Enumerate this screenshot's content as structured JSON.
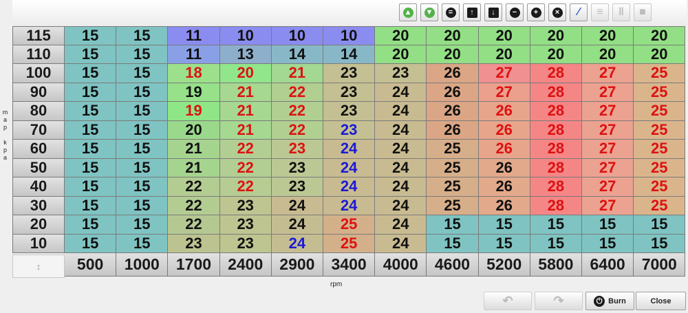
{
  "toolbar": {
    "buttons": [
      {
        "name": "increase-fine-button",
        "icon": "arrow-up-circle-icon",
        "glyph": "▲",
        "fg": "#ffffff",
        "bg": "#55b24a",
        "disabled": false
      },
      {
        "name": "decrease-fine-button",
        "icon": "arrow-down-circle-icon",
        "glyph": "▼",
        "fg": "#ffffff",
        "bg": "#55b24a",
        "disabled": false
      },
      {
        "name": "set-equal-button",
        "icon": "equals-circle-icon",
        "glyph": "=",
        "fg": "#ffffff",
        "bg": "#1a1a1a",
        "disabled": false
      },
      {
        "name": "increase-button",
        "icon": "arrow-up-square-icon",
        "glyph": "↑",
        "fg": "#ffffff",
        "bg": "#1a1a1a",
        "disabled": false
      },
      {
        "name": "decrease-button",
        "icon": "arrow-down-square-icon",
        "glyph": "↓",
        "fg": "#ffffff",
        "bg": "#1a1a1a",
        "disabled": false
      },
      {
        "name": "subtract-button",
        "icon": "minus-circle-icon",
        "glyph": "−",
        "fg": "#ffffff",
        "bg": "#1a1a1a",
        "disabled": false
      },
      {
        "name": "add-button",
        "icon": "plus-circle-icon",
        "glyph": "+",
        "fg": "#ffffff",
        "bg": "#1a1a1a",
        "disabled": false
      },
      {
        "name": "multiply-button",
        "icon": "times-circle-icon",
        "glyph": "×",
        "fg": "#ffffff",
        "bg": "#1a1a1a",
        "disabled": false
      },
      {
        "name": "interpolate-button",
        "icon": "pencil-icon",
        "glyph": "∕",
        "fg": "#2a54c8",
        "bg": "transparent",
        "disabled": false
      },
      {
        "name": "smooth-rows-button",
        "icon": "horizontal-lines-icon",
        "glyph": "≡",
        "fg": "#bdbdbd",
        "bg": "transparent",
        "disabled": true
      },
      {
        "name": "smooth-columns-button",
        "icon": "vertical-lines-icon",
        "glyph": "‖",
        "fg": "#bdbdbd",
        "bg": "transparent",
        "disabled": true
      },
      {
        "name": "smooth-all-button",
        "icon": "square-fill-icon",
        "glyph": "■",
        "fg": "#bdbdbd",
        "bg": "transparent",
        "disabled": true
      }
    ]
  },
  "table": {
    "y_axis_label": "MAP kPa",
    "x_axis_label": "rpm",
    "corner_icon": "axis-corner-icon",
    "corner_glyph": "↕",
    "row_headers": [
      "115",
      "110",
      "100",
      "90",
      "80",
      "70",
      "60",
      "50",
      "40",
      "30",
      "20",
      "10"
    ],
    "col_headers": [
      "500",
      "1000",
      "1700",
      "2400",
      "2900",
      "3400",
      "4000",
      "4600",
      "5200",
      "5800",
      "6400",
      "7000"
    ],
    "values": [
      [
        "15",
        "15",
        "11",
        "10",
        "10",
        "10",
        "20",
        "20",
        "20",
        "20",
        "20",
        "20"
      ],
      [
        "15",
        "15",
        "11",
        "13",
        "14",
        "14",
        "20",
        "20",
        "20",
        "20",
        "20",
        "20"
      ],
      [
        "15",
        "15",
        "18",
        "20",
        "21",
        "23",
        "23",
        "26",
        "27",
        "28",
        "27",
        "25"
      ],
      [
        "15",
        "15",
        "19",
        "21",
        "22",
        "23",
        "24",
        "26",
        "27",
        "28",
        "27",
        "25"
      ],
      [
        "15",
        "15",
        "19",
        "21",
        "22",
        "23",
        "24",
        "26",
        "26",
        "28",
        "27",
        "25"
      ],
      [
        "15",
        "15",
        "20",
        "21",
        "22",
        "23",
        "24",
        "26",
        "26",
        "28",
        "27",
        "25"
      ],
      [
        "15",
        "15",
        "21",
        "22",
        "23",
        "24",
        "24",
        "25",
        "26",
        "28",
        "27",
        "25"
      ],
      [
        "15",
        "15",
        "21",
        "22",
        "23",
        "24",
        "24",
        "25",
        "26",
        "28",
        "27",
        "25"
      ],
      [
        "15",
        "15",
        "22",
        "22",
        "23",
        "24",
        "24",
        "25",
        "26",
        "28",
        "27",
        "25"
      ],
      [
        "15",
        "15",
        "22",
        "23",
        "24",
        "24",
        "24",
        "25",
        "26",
        "28",
        "27",
        "25"
      ],
      [
        "15",
        "15",
        "22",
        "23",
        "24",
        "25",
        "24",
        "15",
        "15",
        "15",
        "15",
        "15"
      ],
      [
        "15",
        "15",
        "23",
        "23",
        "24",
        "25",
        "24",
        "15",
        "15",
        "15",
        "15",
        "15"
      ]
    ],
    "cell_colors": [
      [
        "#7fc4c2",
        "#7fc4c2",
        "#8b8cf0",
        "#8b8cf0",
        "#8b8cf0",
        "#8b8cf0",
        "#93df85",
        "#93df85",
        "#93df85",
        "#93df85",
        "#93df85",
        "#93df85"
      ],
      [
        "#7fc4c2",
        "#7fc4c2",
        "#8aa0e6",
        "#8eafcc",
        "#88b8c8",
        "#88b8c8",
        "#93df85",
        "#93df85",
        "#93df85",
        "#93df85",
        "#93df85",
        "#93df85"
      ],
      [
        "#7fc4c2",
        "#7fc4c2",
        "#9ce08c",
        "#91e58a",
        "#a2d892",
        "#c5c093",
        "#c5c093",
        "#dba686",
        "#f09090",
        "#f58686",
        "#eca290",
        "#dab58c"
      ],
      [
        "#7fc4c2",
        "#7fc4c2",
        "#96e189",
        "#a6d891",
        "#b0cf91",
        "#c5c093",
        "#c9bb91",
        "#dba686",
        "#eba08d",
        "#f58686",
        "#eca290",
        "#dab58c"
      ],
      [
        "#7fc4c2",
        "#7fc4c2",
        "#8fe686",
        "#a6d891",
        "#b0cf91",
        "#c5c093",
        "#c9bb91",
        "#dba686",
        "#e7a58c",
        "#f58686",
        "#eca290",
        "#dab58c"
      ],
      [
        "#7fc4c2",
        "#7fc4c2",
        "#9ad98b",
        "#a6d891",
        "#b0cf91",
        "#c5c093",
        "#c9bb91",
        "#dba686",
        "#e7a58c",
        "#f58686",
        "#eca290",
        "#dab58c"
      ],
      [
        "#7fc4c2",
        "#7fc4c2",
        "#a5d48f",
        "#b3ce93",
        "#bcc894",
        "#c9bb91",
        "#c9bb91",
        "#d7ae8a",
        "#e7a58c",
        "#f58686",
        "#eca290",
        "#dab58c"
      ],
      [
        "#7fc4c2",
        "#7fc4c2",
        "#a5d48f",
        "#b3ce93",
        "#bcc894",
        "#c9bb91",
        "#c9bb91",
        "#d7ae8a",
        "#e3a98b",
        "#f58686",
        "#eca290",
        "#dab58c"
      ],
      [
        "#7fc4c2",
        "#7fc4c2",
        "#b3cc92",
        "#b6cc92",
        "#bcc894",
        "#c9bb91",
        "#c9bb91",
        "#d7ae8a",
        "#e3a98b",
        "#f58686",
        "#eca290",
        "#dab58c"
      ],
      [
        "#7fc4c2",
        "#7fc4c2",
        "#b3cc92",
        "#bec591",
        "#c9bb91",
        "#c9bb91",
        "#c9bb91",
        "#d7ae8a",
        "#e3a98b",
        "#f58686",
        "#eca290",
        "#dab58c"
      ],
      [
        "#7fc4c2",
        "#7fc4c2",
        "#b6c892",
        "#bec591",
        "#c5bd92",
        "#d3b08a",
        "#c9bb91",
        "#7fc4c2",
        "#7fc4c2",
        "#7fc4c2",
        "#7fc4c2",
        "#7fc4c2"
      ],
      [
        "#7fc4c2",
        "#7fc4c2",
        "#bcc390",
        "#bec591",
        "#c5bd92",
        "#d3b08a",
        "#c9bb91",
        "#7fc4c2",
        "#7fc4c2",
        "#7fc4c2",
        "#7fc4c2",
        "#7fc4c2"
      ]
    ],
    "text_colors": [
      [
        "#111111",
        "#111111",
        "#111111",
        "#111111",
        "#111111",
        "#111111",
        "#111111",
        "#111111",
        "#111111",
        "#111111",
        "#111111",
        "#111111"
      ],
      [
        "#111111",
        "#111111",
        "#111111",
        "#111111",
        "#111111",
        "#111111",
        "#111111",
        "#111111",
        "#111111",
        "#111111",
        "#111111",
        "#111111"
      ],
      [
        "#111111",
        "#111111",
        "#dd1111",
        "#dd1111",
        "#dd1111",
        "#111111",
        "#111111",
        "#111111",
        "#dd1111",
        "#dd1111",
        "#dd1111",
        "#dd1111"
      ],
      [
        "#111111",
        "#111111",
        "#111111",
        "#dd1111",
        "#dd1111",
        "#111111",
        "#111111",
        "#111111",
        "#dd1111",
        "#dd1111",
        "#dd1111",
        "#dd1111"
      ],
      [
        "#111111",
        "#111111",
        "#dd1111",
        "#dd1111",
        "#dd1111",
        "#111111",
        "#111111",
        "#111111",
        "#dd1111",
        "#dd1111",
        "#dd1111",
        "#dd1111"
      ],
      [
        "#111111",
        "#111111",
        "#111111",
        "#dd1111",
        "#dd1111",
        "#1a1ad4",
        "#111111",
        "#111111",
        "#dd1111",
        "#dd1111",
        "#dd1111",
        "#dd1111"
      ],
      [
        "#111111",
        "#111111",
        "#111111",
        "#dd1111",
        "#dd1111",
        "#1a1ad4",
        "#111111",
        "#111111",
        "#dd1111",
        "#dd1111",
        "#dd1111",
        "#dd1111"
      ],
      [
        "#111111",
        "#111111",
        "#111111",
        "#dd1111",
        "#111111",
        "#1a1ad4",
        "#111111",
        "#111111",
        "#111111",
        "#dd1111",
        "#dd1111",
        "#dd1111"
      ],
      [
        "#111111",
        "#111111",
        "#111111",
        "#dd1111",
        "#111111",
        "#1a1ad4",
        "#111111",
        "#111111",
        "#111111",
        "#dd1111",
        "#dd1111",
        "#dd1111"
      ],
      [
        "#111111",
        "#111111",
        "#111111",
        "#111111",
        "#111111",
        "#1a1ad4",
        "#111111",
        "#111111",
        "#111111",
        "#dd1111",
        "#dd1111",
        "#dd1111"
      ],
      [
        "#111111",
        "#111111",
        "#111111",
        "#111111",
        "#111111",
        "#dd1111",
        "#111111",
        "#111111",
        "#111111",
        "#111111",
        "#111111",
        "#111111"
      ],
      [
        "#111111",
        "#111111",
        "#111111",
        "#111111",
        "#1a1ad4",
        "#dd1111",
        "#111111",
        "#111111",
        "#111111",
        "#111111",
        "#111111",
        "#111111"
      ]
    ]
  },
  "footer": {
    "undo_icon": "undo-arrow-icon",
    "redo_icon": "redo-arrow-icon",
    "undo_glyph": "↶",
    "redo_glyph": "↷",
    "burn_icon": "power-icon",
    "burn_glyph": "⏻",
    "burn_label": "Burn",
    "close_label": "Close"
  }
}
